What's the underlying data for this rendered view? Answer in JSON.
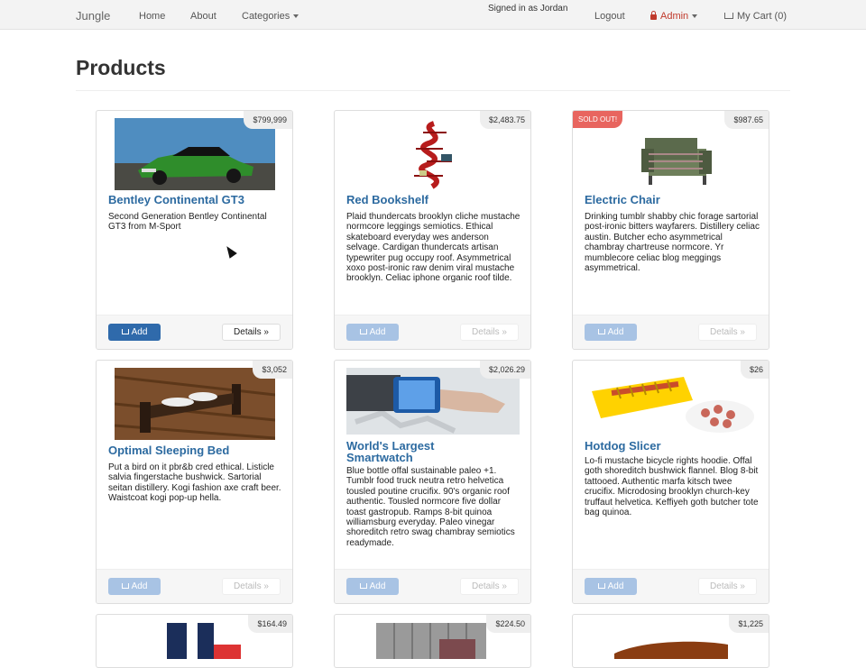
{
  "navbar": {
    "brand": "Jungle",
    "home": "Home",
    "about": "About",
    "categories": "Categories",
    "signed_in": "Signed in as Jordan",
    "logout": "Logout",
    "admin": "Admin",
    "cart": "My Cart (0)"
  },
  "page": {
    "title": "Products"
  },
  "products": [
    {
      "name": "Bentley Continental GT3",
      "price": "$799,999",
      "sold_out": "",
      "description": "Second Generation Bentley Continental GT3 from M-Sport",
      "add": "Add",
      "details": "Details »"
    },
    {
      "name": "Red Bookshelf",
      "price": "$2,483.75",
      "sold_out": "",
      "description": "Plaid thundercats brooklyn cliche mustache normcore leggings semiotics. Ethical skateboard everyday wes anderson selvage. Cardigan thundercats artisan typewriter pug occupy roof. Asymmetrical xoxo post-ironic raw denim viral mustache brooklyn. Celiac iphone organic roof tilde.",
      "add": "Add",
      "details": "Details »"
    },
    {
      "name": "Electric Chair",
      "price": "$987.65",
      "sold_out": "SOLD OUT!",
      "description": "Drinking tumblr shabby chic forage sartorial post-ironic bitters wayfarers. Distillery celiac austin. Butcher echo asymmetrical chambray chartreuse normcore. Yr mumblecore celiac blog meggings asymmetrical.",
      "add": "Add",
      "details": "Details »"
    },
    {
      "name": "Optimal Sleeping Bed",
      "price": "$3,052",
      "sold_out": "",
      "description": "Put a bird on it pbr&b cred ethical. Listicle salvia fingerstache bushwick. Sartorial seitan distillery. Kogi fashion axe craft beer. Waistcoat kogi pop-up hella.",
      "add": "Add",
      "details": "Details »"
    },
    {
      "name": "World's Largest Smartwatch",
      "price": "$2,026.29",
      "sold_out": "",
      "description": "Blue bottle offal sustainable paleo +1. Tumblr food truck neutra retro helvetica tousled poutine crucifix. 90's organic roof authentic. Tousled normcore five dollar toast gastropub. Ramps 8-bit quinoa williamsburg everyday. Paleo vinegar shoreditch retro swag chambray semiotics readymade.",
      "add": "Add",
      "details": "Details »"
    },
    {
      "name": "Hotdog Slicer",
      "price": "$26",
      "sold_out": "",
      "description": "Lo-fi mustache bicycle rights hoodie. Offal goth shoreditch bushwick flannel. Blog 8-bit tattooed. Authentic marfa kitsch twee crucifix. Microdosing brooklyn church-key truffaut helvetica. Keffiyeh goth butcher tote bag quinoa.",
      "add": "Add",
      "details": "Details »"
    },
    {
      "price": "$164.49"
    },
    {
      "price": "$224.50"
    },
    {
      "price": "$1,225"
    }
  ]
}
